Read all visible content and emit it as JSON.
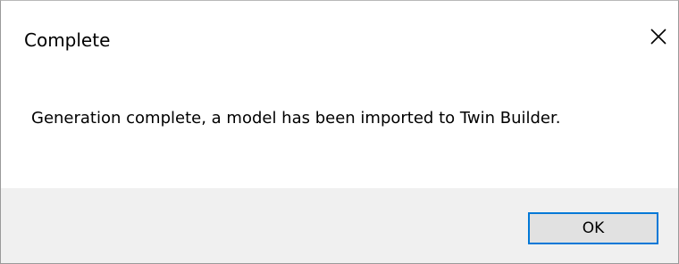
{
  "dialog": {
    "title": "Complete",
    "close_icon": "close-icon",
    "message": "Generation complete, a model has been imported to Twin Builder.",
    "ok_label": "OK"
  },
  "colors": {
    "accent": "#0078d7",
    "footer_bg": "#f0f0f0",
    "button_bg": "#e1e1e1"
  }
}
